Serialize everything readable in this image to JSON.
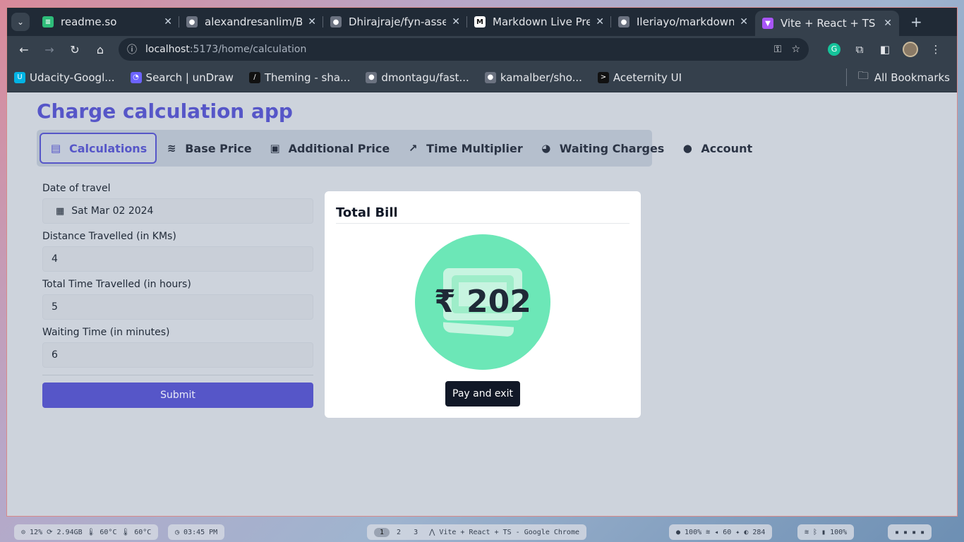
{
  "browser": {
    "tabs": [
      {
        "title": "readme.so",
        "icon": "readme-icon",
        "color": "#2ebd7a",
        "glyph": "≡"
      },
      {
        "title": "alexandresanlim/Ba",
        "icon": "github-icon",
        "color": "#6b7280",
        "glyph": "●"
      },
      {
        "title": "Dhirajraje/fyn-asse",
        "icon": "github-icon",
        "color": "#6b7280",
        "glyph": "●"
      },
      {
        "title": "Markdown Live Prev",
        "icon": "markdown-icon",
        "color": "#ffffff",
        "glyph": "M"
      },
      {
        "title": "Ileriayo/markdown-",
        "icon": "github-icon",
        "color": "#6b7280",
        "glyph": "●"
      },
      {
        "title": "Vite + React + TS",
        "icon": "vite-icon",
        "color": "#a855f7",
        "glyph": "▼"
      }
    ],
    "active_tab": 5,
    "url_host": "localhost",
    "url_path": ":5173/home/calculation",
    "bookmarks": [
      {
        "label": "Udacity-Googl...",
        "color": "#02b3e4",
        "glyph": "U"
      },
      {
        "label": "Search | unDraw",
        "color": "#6c63ff",
        "glyph": "◔"
      },
      {
        "label": "Theming - sha...",
        "color": "#111111",
        "glyph": "/"
      },
      {
        "label": "dmontagu/fast...",
        "color": "#6b7280",
        "glyph": "●"
      },
      {
        "label": "kamalber/sho...",
        "color": "#6b7280",
        "glyph": "●"
      },
      {
        "label": "Aceternity UI",
        "color": "#111111",
        "glyph": ">"
      }
    ],
    "all_bookmarks": "All Bookmarks"
  },
  "app": {
    "title": "Charge calculation app",
    "nav": [
      {
        "label": "Calculations",
        "icon": "calculator-icon",
        "glyph": "▤"
      },
      {
        "label": "Base Price",
        "icon": "coins-stack-icon",
        "glyph": "≋"
      },
      {
        "label": "Additional Price",
        "icon": "banknote-icon",
        "glyph": "▣"
      },
      {
        "label": "Time Multiplier",
        "icon": "trending-up-icon",
        "glyph": "↗"
      },
      {
        "label": "Waiting Charges",
        "icon": "clock-icon",
        "glyph": "◕"
      },
      {
        "label": "Account",
        "icon": "user-icon",
        "glyph": "●"
      }
    ],
    "active_nav": 0,
    "form": {
      "date_label": "Date of travel",
      "date_value": "Sat Mar 02 2024",
      "distance_label": "Distance Travelled (in KMs)",
      "distance_value": "4",
      "time_label": "Total Time Travelled (in hours)",
      "time_value": "5",
      "waiting_label": "Waiting Time (in minutes)",
      "waiting_value": "6",
      "submit_label": "Submit"
    },
    "bill": {
      "title": "Total Bill",
      "amount": "₹ 202",
      "pay_label": "Pay and exit"
    }
  },
  "taskbar": {
    "system": "⊙ 12%  ⟳ 2.94GB  🌡 60°C  🌡 60°C",
    "clock": "◷ 03:45 PM",
    "workspaces": [
      "1",
      "2",
      "3"
    ],
    "window_title": "⋀ Vite + React + TS - Google Chrome",
    "status": "● 100%  ≋  ◂ 60  ✦  ◐ 284",
    "tray": "≋  ᛒ  ▮ 100%",
    "power": "▪ ▪ ▪ ▪"
  }
}
